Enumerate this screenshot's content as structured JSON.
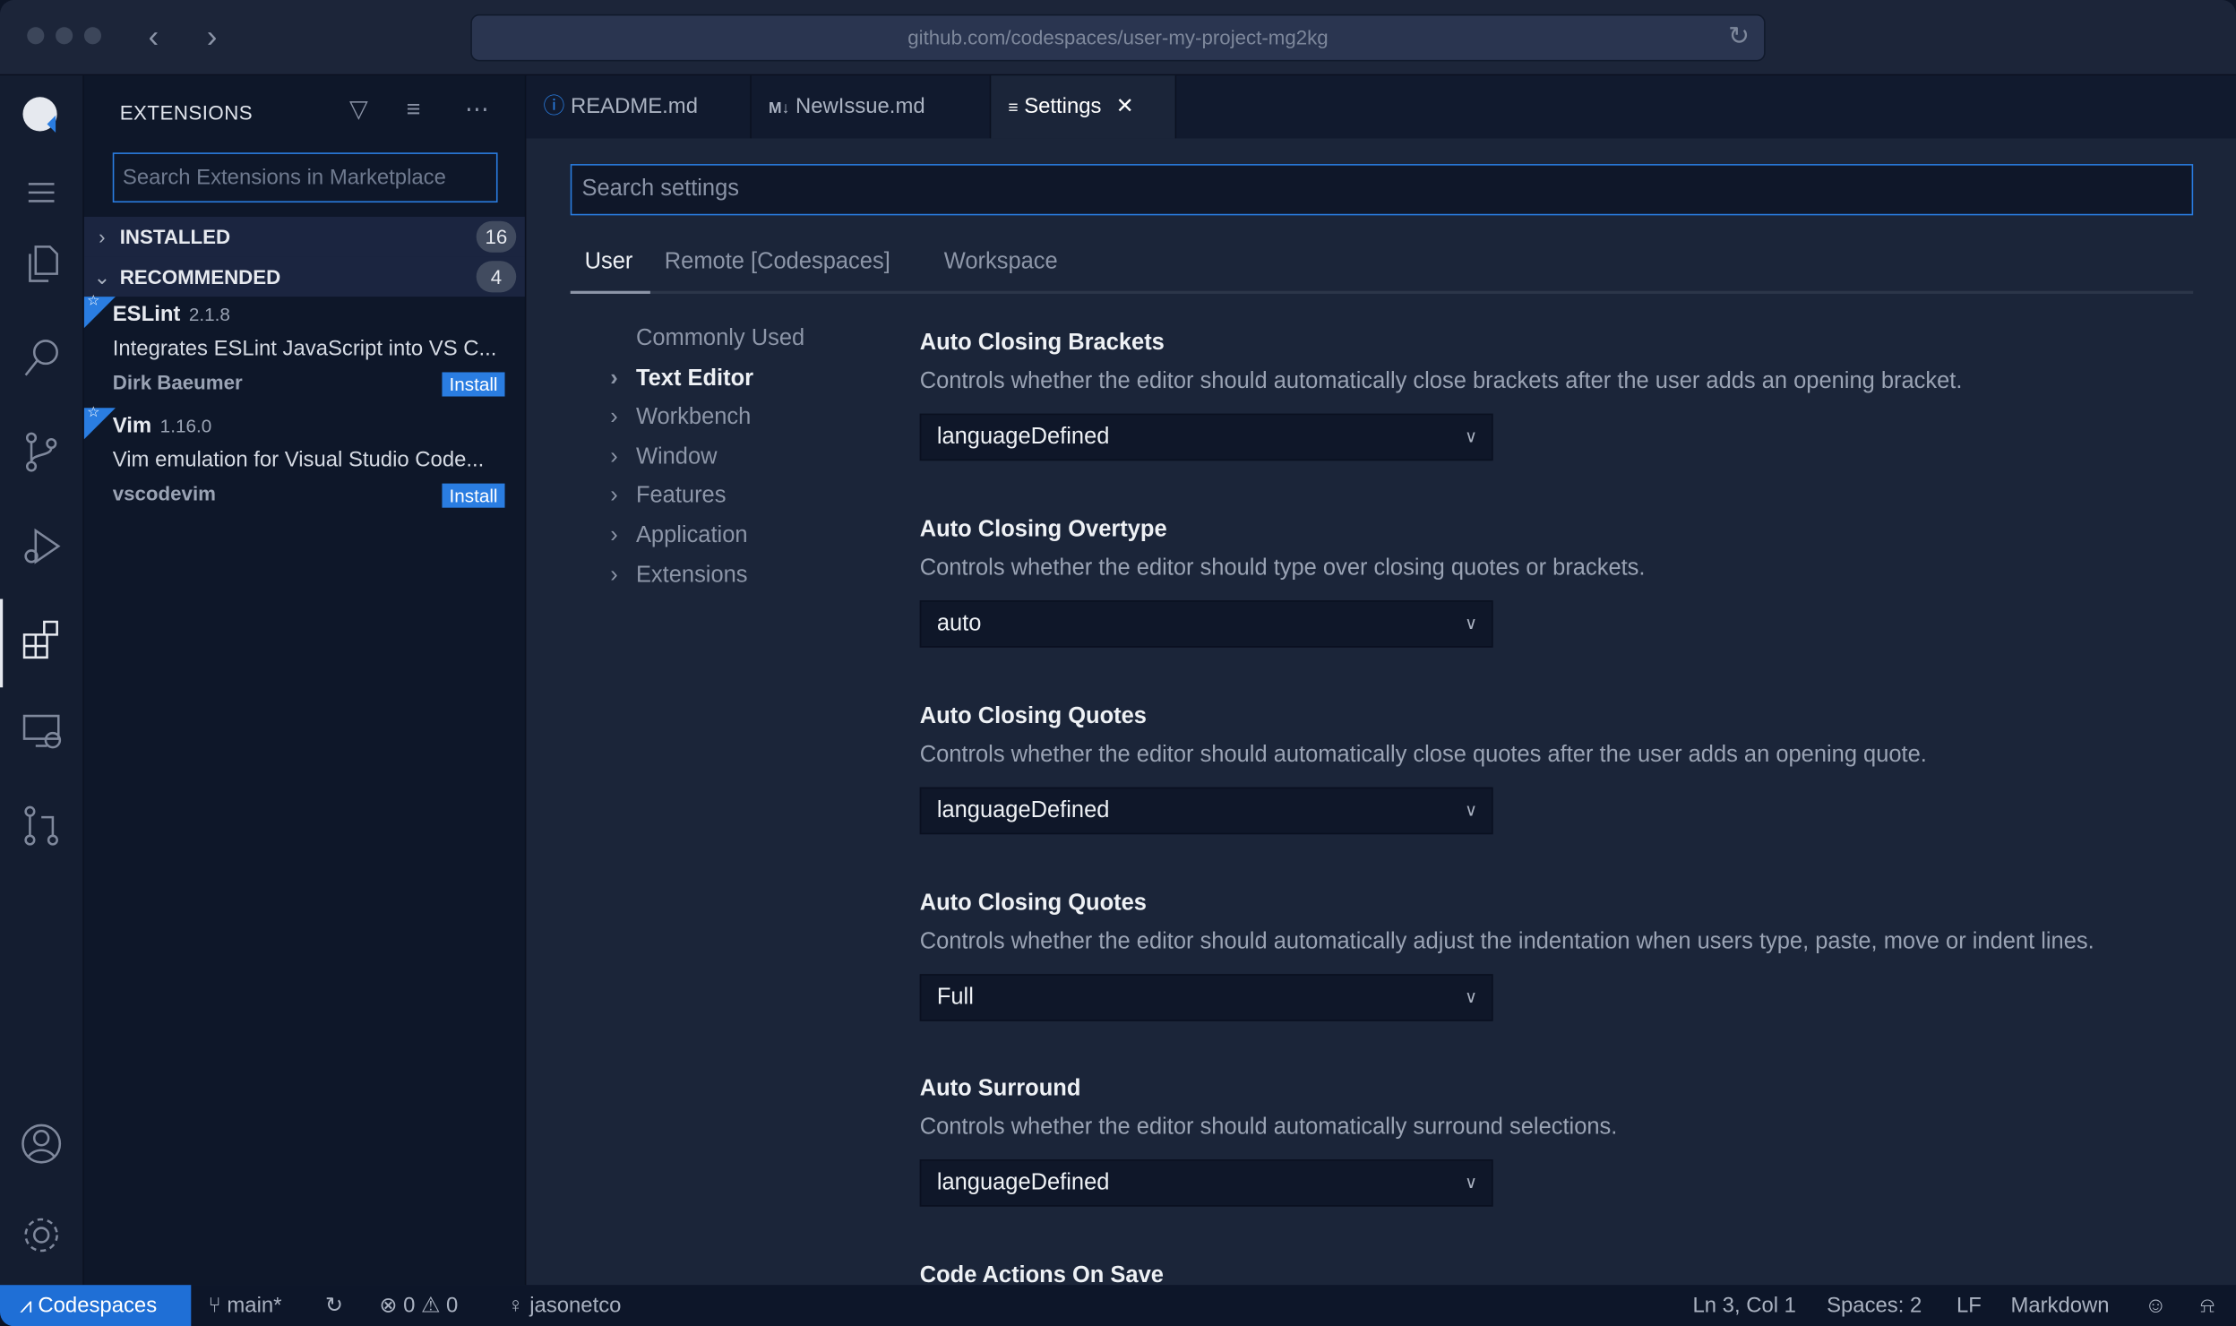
{
  "browser": {
    "url": "github.com/codespaces/user-my-project-mg2kg"
  },
  "sidebar": {
    "title": "EXTENSIONS",
    "search_placeholder": "Search Extensions in Marketplace",
    "sections": [
      {
        "label": "INSTALLED",
        "count": "16"
      },
      {
        "label": "RECOMMENDED",
        "count": "4"
      }
    ],
    "extensions": [
      {
        "name": "ESLint",
        "version": "2.1.8",
        "description": "Integrates ESLint JavaScript into VS C...",
        "author": "Dirk Baeumer",
        "action": "Install"
      },
      {
        "name": "Vim",
        "version": "1.16.0",
        "description": "Vim emulation for Visual Studio Code...",
        "author": "vscodevim",
        "action": "Install"
      }
    ]
  },
  "tabs": [
    {
      "label": "README.md",
      "icon": "info-icon"
    },
    {
      "label": "NewIssue.md",
      "icon": "markdown-icon"
    },
    {
      "label": "Settings",
      "icon": "settings-file-icon",
      "active": true
    }
  ],
  "settings": {
    "search_placeholder": "Search settings",
    "scopes": [
      "User",
      "Remote [Codespaces]",
      "Workspace"
    ],
    "toc": [
      "Commonly Used",
      "Text Editor",
      "Workbench",
      "Window",
      "Features",
      "Application",
      "Extensions"
    ],
    "items": [
      {
        "title": "Auto Closing Brackets",
        "description": "Controls whether the editor should automatically close brackets after the user adds an opening bracket.",
        "value": "languageDefined"
      },
      {
        "title": "Auto Closing Overtype",
        "description": "Controls whether the editor should type over closing quotes or brackets.",
        "value": "auto"
      },
      {
        "title": "Auto Closing Quotes",
        "description": "Controls whether the editor should automatically close quotes after the user adds an opening quote.",
        "value": "languageDefined"
      },
      {
        "title": "Auto Closing Quotes",
        "description": "Controls whether the editor should automatically adjust the indentation when users type, paste, move or indent lines.",
        "value": "Full"
      },
      {
        "title": "Auto Surround",
        "description": "Controls whether the editor should automatically surround selections.",
        "value": "languageDefined"
      },
      {
        "title": "Code Actions On Save"
      }
    ]
  },
  "status": {
    "remote": "Codespaces",
    "branch": "main*",
    "errors": "0",
    "warnings": "0",
    "user": "jasonetco",
    "position": "Ln 3, Col 1",
    "spaces": "Spaces: 2",
    "eol": "LF",
    "language": "Markdown"
  },
  "colors": {
    "accent": "#2a7de1",
    "status_remote": "#1f6fd6"
  }
}
